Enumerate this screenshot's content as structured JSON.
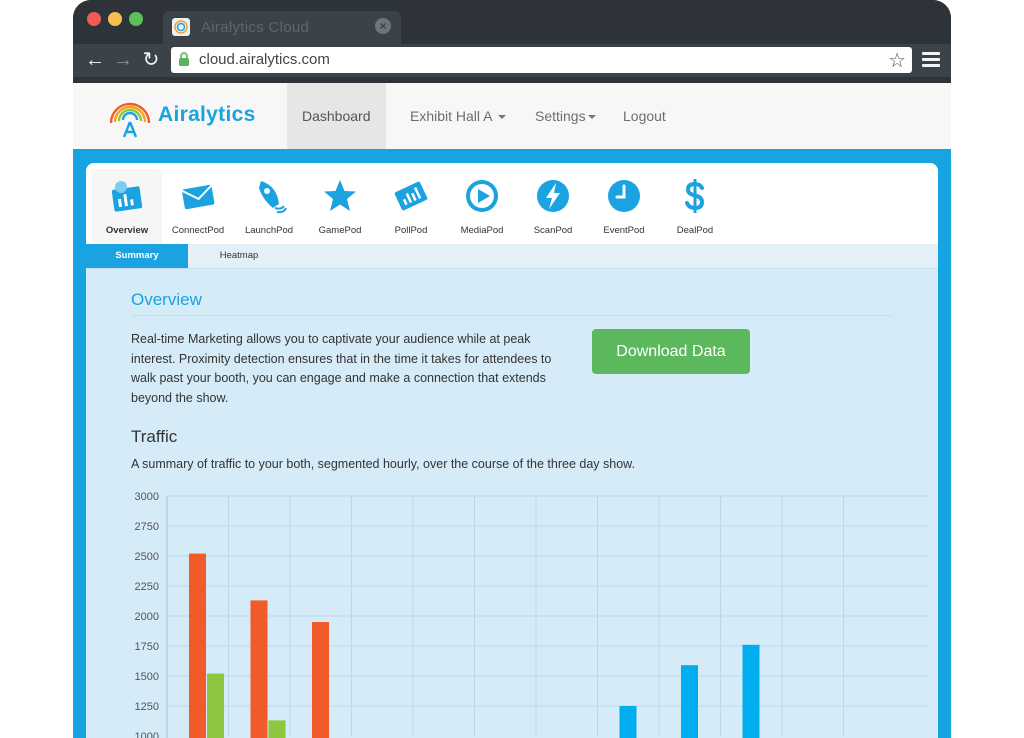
{
  "browser": {
    "tab_title": "Airalytics Cloud",
    "url": "cloud.airalytics.com"
  },
  "site": {
    "brand": "Airalytics",
    "nav": [
      {
        "label": "Dashboard",
        "active": true
      },
      {
        "label": "Exhibit Hall A",
        "dropdown": true
      },
      {
        "label": "Settings",
        "dropdown": true
      },
      {
        "label": "Logout"
      }
    ]
  },
  "pods": [
    {
      "label": "Overview",
      "icon": "overview-icon",
      "active": true
    },
    {
      "label": "ConnectPod",
      "icon": "envelope-icon"
    },
    {
      "label": "LaunchPod",
      "icon": "rocket-icon"
    },
    {
      "label": "GamePod",
      "icon": "star-icon"
    },
    {
      "label": "PollPod",
      "icon": "ticket-icon"
    },
    {
      "label": "MediaPod",
      "icon": "play-icon"
    },
    {
      "label": "ScanPod",
      "icon": "lightning-icon"
    },
    {
      "label": "EventPod",
      "icon": "clock-icon"
    },
    {
      "label": "DealPod",
      "icon": "dollar-icon"
    }
  ],
  "subtabs": {
    "summary": "Summary",
    "heatmap": "Heatmap"
  },
  "overview": {
    "heading": "Overview",
    "body": "Real-time Marketing allows you to captivate your audience while at peak interest. Proximity detection ensures that in the time it takes for attendees to walk past your booth, you can engage and make a connection that extends beyond the show.",
    "download_label": "Download Data"
  },
  "traffic": {
    "heading": "Traffic",
    "description": "A summary of traffic to your both, segmented hourly, over the course of the three day show."
  },
  "colors": {
    "brand_blue": "#1ba2e0",
    "bar_orange": "#f15a29",
    "bar_green": "#8dc63f",
    "bar_blue": "#00aeef",
    "button_green": "#5cb85c"
  },
  "chart_data": {
    "type": "bar",
    "ylim": [
      1000,
      3000
    ],
    "yticks": [
      1000,
      1250,
      1500,
      1750,
      2000,
      2250,
      2500,
      2750,
      3000
    ],
    "grid": true,
    "groups": 11,
    "bars": [
      {
        "group": 0,
        "slot": 0,
        "value": 2520,
        "color": "#f15a29"
      },
      {
        "group": 0,
        "slot": 1,
        "value": 1520,
        "color": "#8dc63f"
      },
      {
        "group": 1,
        "slot": 0,
        "value": 2130,
        "color": "#f15a29"
      },
      {
        "group": 1,
        "slot": 1,
        "value": 1130,
        "color": "#8dc63f"
      },
      {
        "group": 2,
        "slot": 0,
        "value": 1950,
        "color": "#f15a29"
      },
      {
        "group": 7,
        "slot": 0,
        "value": 1250,
        "color": "#00aeef"
      },
      {
        "group": 8,
        "slot": 0,
        "value": 1590,
        "color": "#00aeef"
      },
      {
        "group": 9,
        "slot": 0,
        "value": 1760,
        "color": "#00aeef"
      }
    ]
  }
}
